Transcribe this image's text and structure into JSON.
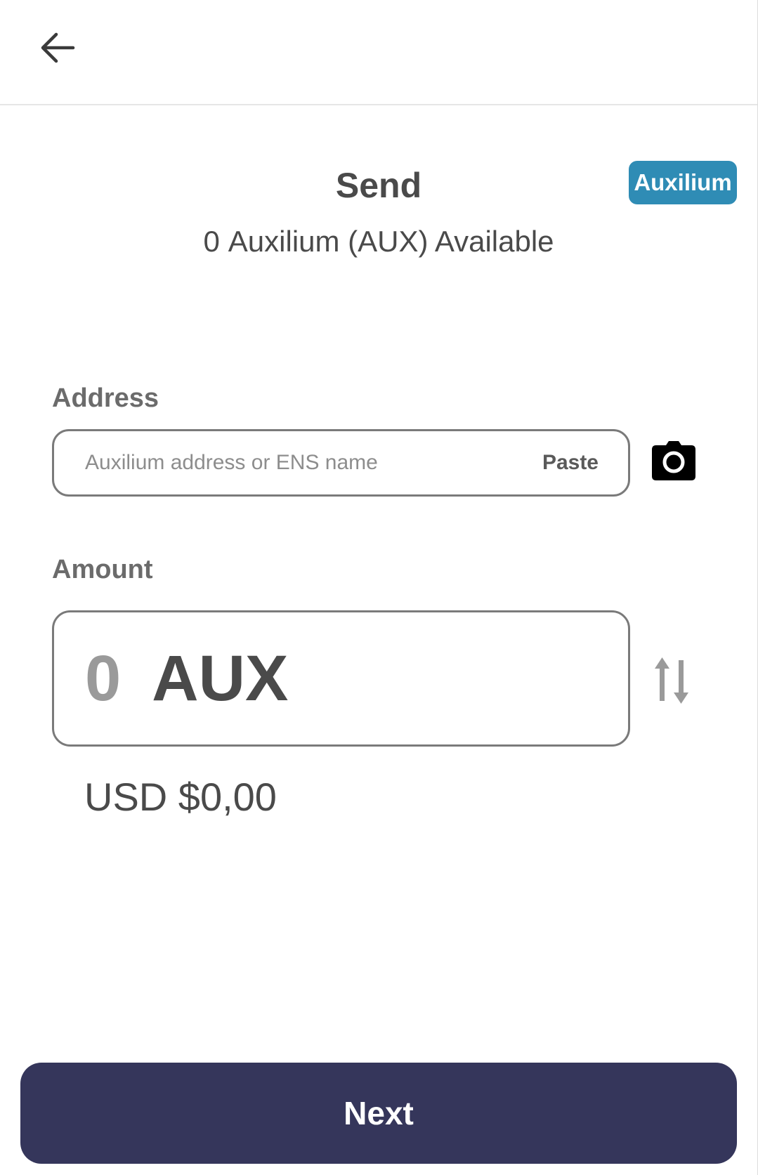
{
  "header": {
    "back_icon": "arrow-left-icon"
  },
  "send": {
    "title": "Send",
    "available_amount": "0",
    "available_text": "Auxilium (AUX) Available",
    "network_badge": "Auxilium"
  },
  "address": {
    "label": "Address",
    "placeholder": "Auxilium address or ENS name",
    "value": "",
    "paste_label": "Paste",
    "scan_icon": "camera-icon"
  },
  "amount": {
    "label": "Amount",
    "value": "0",
    "unit": "AUX",
    "swap_icon": "swap-vertical-icon",
    "fiat": "USD $0,00"
  },
  "footer": {
    "next_label": "Next"
  },
  "colors": {
    "badge": "#2f8cb5",
    "primary_button": "#35365b",
    "text": "#4a4a4a",
    "muted": "#9a9a9a"
  }
}
